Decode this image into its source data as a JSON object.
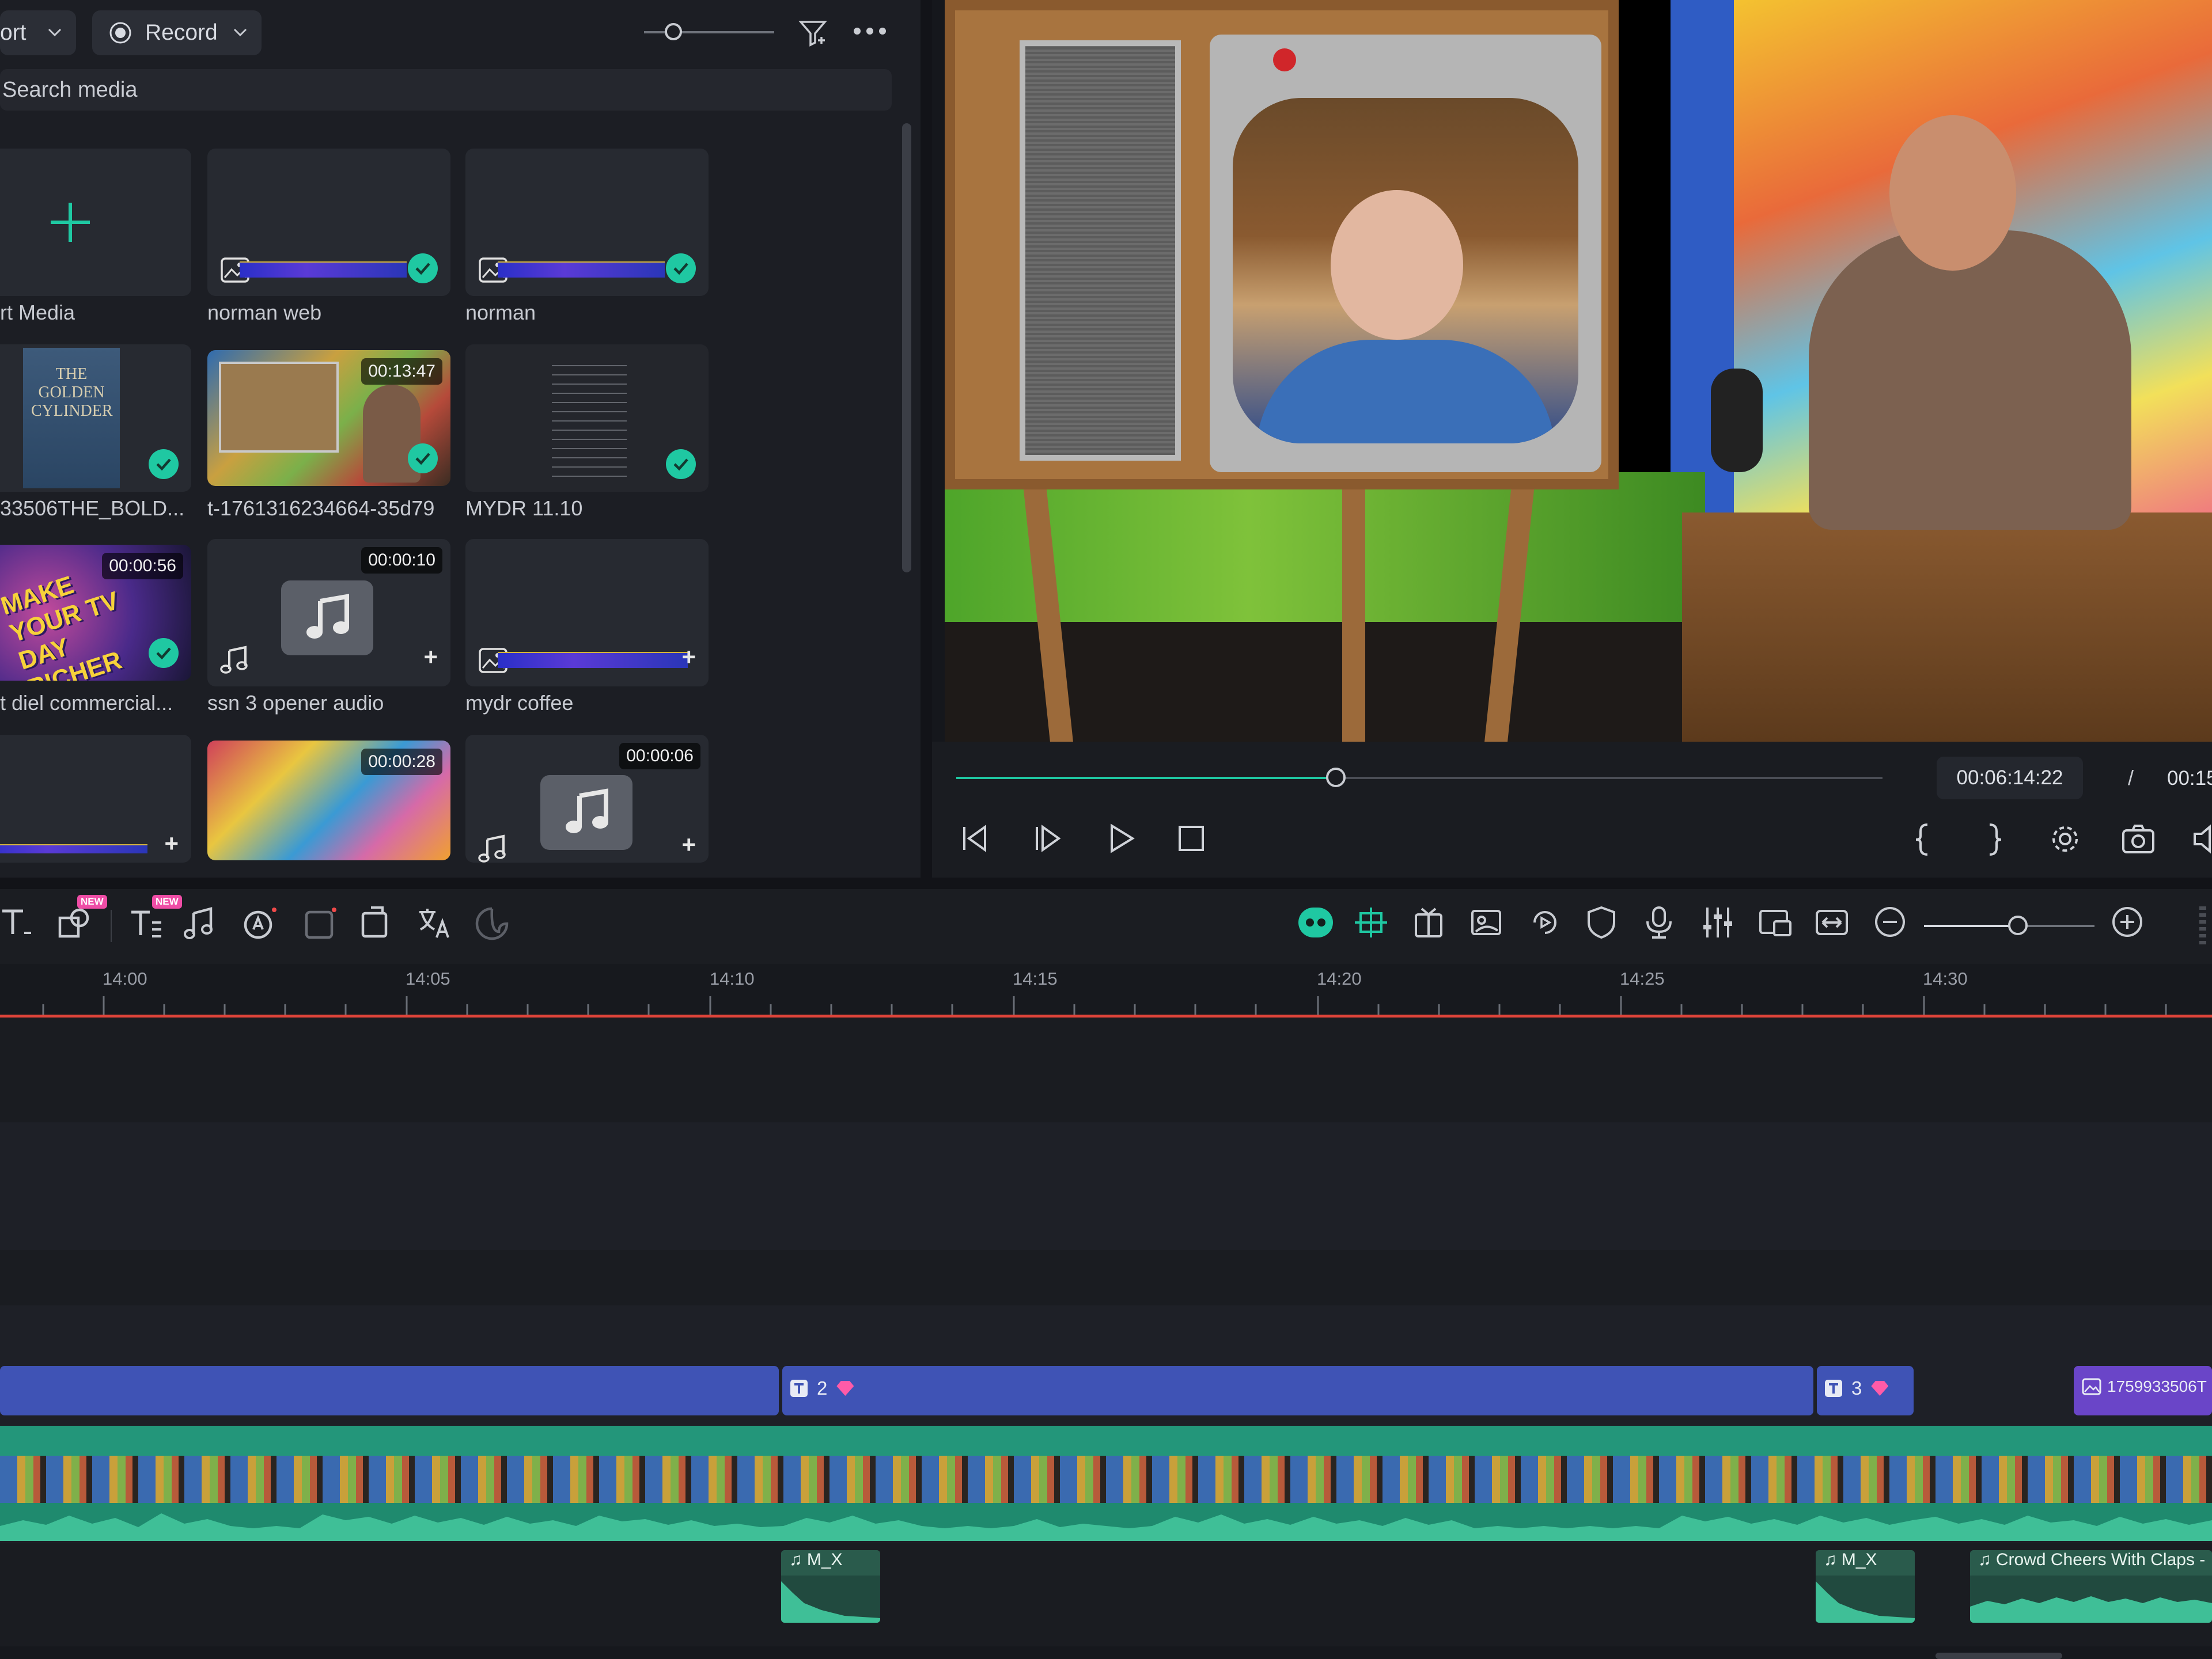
{
  "media_panel": {
    "import_label": "ort",
    "record_label": "Record",
    "search_placeholder": "Search media",
    "items": [
      {
        "label": "rt Media"
      },
      {
        "label": "norman web"
      },
      {
        "label": "norman"
      },
      {
        "label": "33506THE_BOLD...",
        "thumb_text": "THE GOLDEN CYLINDER"
      },
      {
        "label": "t-1761316234664-35d79",
        "duration": "00:13:47"
      },
      {
        "label": "MYDR 11.10"
      },
      {
        "label": "t diel commercial...",
        "duration": "00:00:56",
        "thumb_text": "MAKE YOUR TV DAY RICHER"
      },
      {
        "label": "ssn 3 opener audio",
        "duration": "00:00:10"
      },
      {
        "label": "mydr coffee"
      },
      {
        "label": ""
      },
      {
        "label": "",
        "duration": "00:00:28"
      },
      {
        "label": "",
        "duration": "00:00:06"
      }
    ]
  },
  "player": {
    "current_time": "00:06:14:22",
    "separator": "/",
    "total_time": "00:15",
    "progress": 0.41
  },
  "ruler": {
    "labels": [
      "14:00",
      "14:05",
      "14:10",
      "14:15",
      "14:20",
      "14:25",
      "14:30"
    ]
  },
  "timeline": {
    "zoom_level": 0.55,
    "title_clips": [
      {
        "label": "2"
      },
      {
        "label": "3"
      },
      {
        "label": "1759933506T"
      }
    ],
    "audio_clips": [
      {
        "label": "M_X"
      },
      {
        "label": "M_X"
      },
      {
        "label": "Crowd Cheers With Claps -"
      }
    ]
  },
  "badges": {
    "new": "NEW"
  },
  "colors": {
    "accent": "#1fc8a2",
    "clip_blue": "#3f53b5",
    "clip_purple": "#6a45c8",
    "video_track": "#1f8a6e",
    "playhead": "#e0443a"
  }
}
